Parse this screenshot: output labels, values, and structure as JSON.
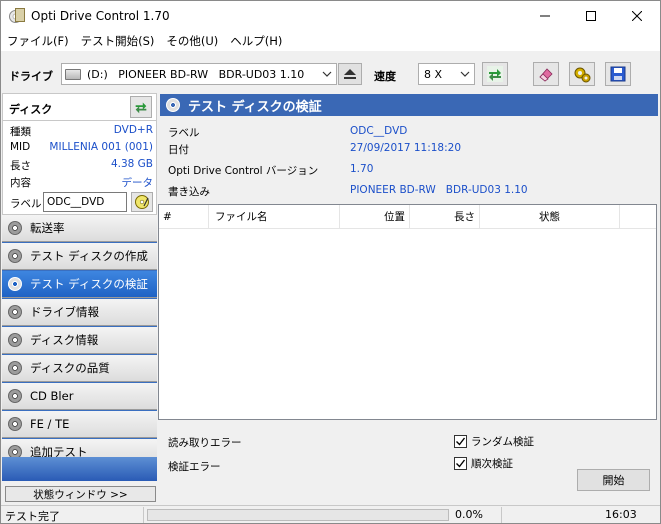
{
  "window": {
    "title": "Opti Drive Control 1.70",
    "minimize": "—",
    "maximize": "☐",
    "close": "✕"
  },
  "menu": [
    "ファイル(F)",
    "テスト開始(S)",
    "その他(U)",
    "ヘルプ(H)"
  ],
  "toolbar": {
    "drive_label": "ドライブ",
    "drive_value": "(D:)   PIONEER BD-RW   BDR-UD03 1.10",
    "speed_label": "速度",
    "speed_value": "8 X"
  },
  "disc_panel": {
    "header": "ディスク",
    "rows": [
      {
        "key": "種類",
        "value": "DVD+R"
      },
      {
        "key": "MID",
        "value": "MILLENIA 001 (001)"
      },
      {
        "key": "長さ",
        "value": "4.38 GB"
      },
      {
        "key": "内容",
        "value": "データ"
      }
    ],
    "label_key": "ラベル",
    "label_value": "ODC__DVD"
  },
  "nav": [
    {
      "label": "転送率",
      "active": false
    },
    {
      "label": "テスト ディスクの作成",
      "active": false
    },
    {
      "label": "テスト ディスクの検証",
      "active": true
    },
    {
      "label": "ドライブ情報",
      "active": false
    },
    {
      "label": "ディスク情報",
      "active": false
    },
    {
      "label": "ディスクの品質",
      "active": false
    },
    {
      "label": "CD Bler",
      "active": false
    },
    {
      "label": "FE / TE",
      "active": false
    },
    {
      "label": "追加テスト",
      "active": false
    }
  ],
  "status_window_button": "状態ウィンドウ >>",
  "main": {
    "title": "テスト ディスクの検証",
    "props": [
      {
        "key": "ラベル",
        "value": "ODC__DVD"
      },
      {
        "key": "日付",
        "value": "27/09/2017 11:18:20"
      },
      {
        "key": "Opti Drive Control バージョン",
        "value": "1.70"
      },
      {
        "key": "書き込み",
        "value": "PIONEER BD-RW   BDR-UD03 1.10"
      }
    ],
    "columns": [
      "#",
      "ファイル名",
      "位置",
      "長さ",
      "状態"
    ],
    "read_error_label": "読み取りエラー",
    "verify_error_label": "検証エラー",
    "random_verify_label": "ランダム検証",
    "random_verify_checked": true,
    "sequential_verify_label": "順次検証",
    "sequential_verify_checked": true,
    "start_button": "開始"
  },
  "statusbar": {
    "status": "テスト完了",
    "progress_percent": 0,
    "progress_text": "0.0%",
    "time": "16:03"
  },
  "colors": {
    "accent": "#3a68b5",
    "value_text": "#1b4fc9",
    "active_nav": "#1f62c4"
  }
}
